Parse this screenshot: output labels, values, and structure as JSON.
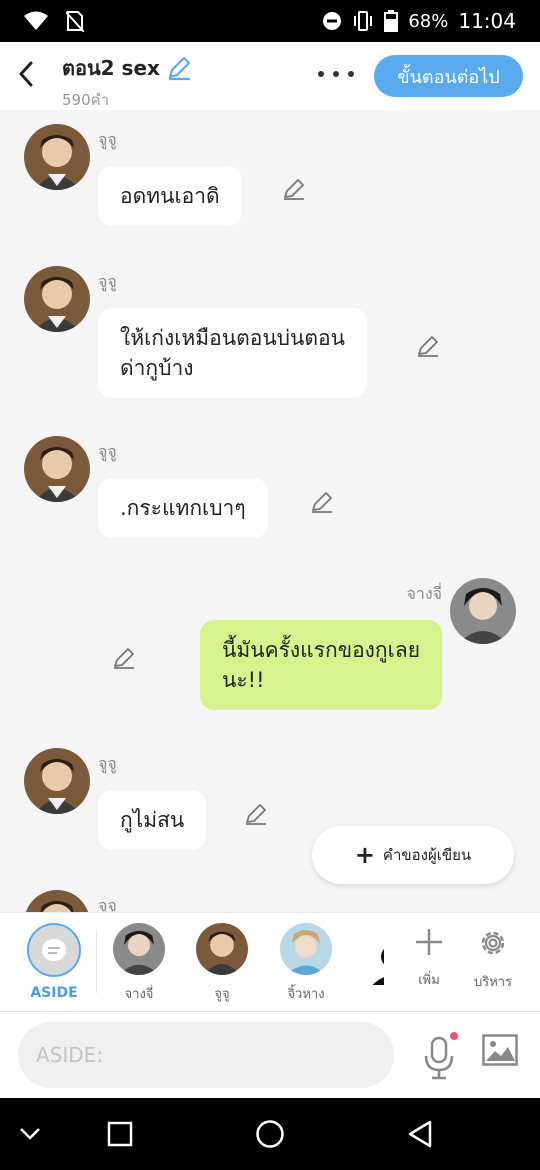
{
  "status_bar": {
    "battery": "68%",
    "time": "11:04",
    "icons": [
      "wifi-icon",
      "no-sim-icon",
      "do-not-disturb-icon",
      "vibrate-icon",
      "battery-icon"
    ]
  },
  "header": {
    "title": "ตอน2 sex",
    "subtitle": "590คำ",
    "next_button": "ขั้นตอนต่อไป"
  },
  "messages": [
    {
      "sender": "จูจู",
      "text": "อดทนเอาดิ",
      "side": "left"
    },
    {
      "sender": "จูจู",
      "text": "ให้เก่งเหมือนตอนบ่นตอน\nด่ากูบ้าง",
      "side": "left"
    },
    {
      "sender": "จูจู",
      "text": ".กระแทกเบาๆ",
      "side": "left"
    },
    {
      "sender": "จางจี่",
      "text": "นี้มันครั้งแรกของกูเลย\nนะ!!",
      "side": "right"
    },
    {
      "sender": "จูจู",
      "text": "กูไม่สน",
      "side": "left"
    },
    {
      "sender": "จูจู",
      "text": "",
      "side": "left"
    }
  ],
  "fab": {
    "label": "คำของผู้เขียน"
  },
  "char_bar": {
    "aside_label": "ASIDE",
    "characters": [
      {
        "name": "จางจี่"
      },
      {
        "name": "จูจู"
      },
      {
        "name": "จิ้วหาง"
      }
    ],
    "add_label": "เพิ่ม",
    "manage_label": "บริหาร"
  },
  "input": {
    "placeholder": "ASIDE:"
  },
  "colors": {
    "accent": "#5aaaf0",
    "right_bubble": "#d8f28e",
    "background": "#f5f5f5"
  }
}
